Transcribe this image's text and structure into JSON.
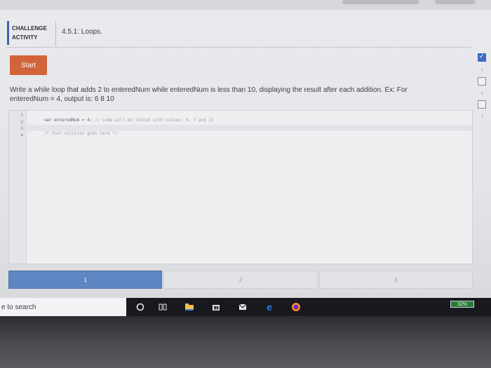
{
  "challenge": {
    "label_line1": "CHALLENGE",
    "label_line2": "ACTIVITY",
    "title": "4.5.1: Loops."
  },
  "start_label": "Start",
  "instructions": {
    "line1": "Write a while loop that adds 2 to enteredNum while enteredNum is less than 10, displaying the result after each addition. Ex: For",
    "line2": "enteredNum = 4, output is: 6 8 10"
  },
  "editor": {
    "line_numbers": [
      "1",
      "2",
      "3",
      "4"
    ],
    "line1_keyword": "var",
    "line1_code": " enteredNum = 4; ",
    "line1_comment": "// Code will be tested with values: 4, 7 and 15",
    "line3_comment": "/* Your solution goes here */"
  },
  "progress": {
    "segments": [
      "1",
      "2",
      "3"
    ],
    "current": 1
  },
  "right_rail": {
    "numbers": [
      "1",
      "2",
      "3"
    ]
  },
  "taskbar": {
    "search_text": "e to search",
    "battery": "32%",
    "icons": [
      "cortana-circle-icon",
      "task-view-icon",
      "file-explorer-icon",
      "store-icon",
      "mail-icon",
      "edge-icon",
      "firefox-icon"
    ]
  },
  "colors": {
    "accent": "#d1643a",
    "progress_active": "#5d86c2",
    "check_blue": "#3f6bc4"
  }
}
